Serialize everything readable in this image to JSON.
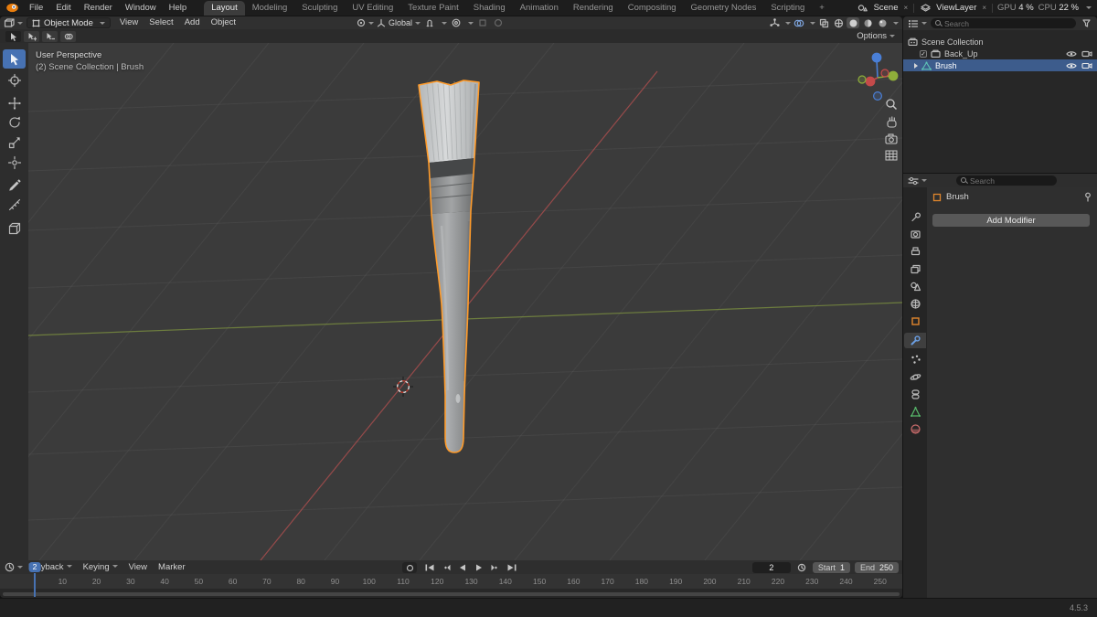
{
  "colors": {
    "accent_blue": "#4772b3",
    "selection_orange": "#ff9b2a",
    "axis_red": "#a84e4e",
    "axis_green": "#7b8e40",
    "outliner_selection": "#3d5c8c"
  },
  "icons": {
    "close": "×",
    "check": "✓"
  },
  "topbar": {
    "menus": [
      {
        "label": "File"
      },
      {
        "label": "Edit"
      },
      {
        "label": "Render"
      },
      {
        "label": "Window"
      },
      {
        "label": "Help"
      }
    ],
    "workspaces": [
      {
        "label": "Layout",
        "active": true
      },
      {
        "label": "Modeling"
      },
      {
        "label": "Sculpting"
      },
      {
        "label": "UV Editing"
      },
      {
        "label": "Texture Paint"
      },
      {
        "label": "Shading"
      },
      {
        "label": "Animation"
      },
      {
        "label": "Rendering"
      },
      {
        "label": "Compositing"
      },
      {
        "label": "Geometry Nodes"
      },
      {
        "label": "Scripting"
      },
      {
        "label": "+"
      }
    ],
    "scene_name": "Scene",
    "view_layer_name": "ViewLayer",
    "gpu_label": "GPU",
    "gpu_value": "4 %",
    "cpu_label": "CPU",
    "cpu_value": "22 %"
  },
  "viewport_header": {
    "mode": "Object Mode",
    "menus": [
      {
        "label": "View"
      },
      {
        "label": "Select"
      },
      {
        "label": "Add"
      },
      {
        "label": "Object"
      }
    ],
    "orientation": "Global"
  },
  "tool_settings": {
    "options_label": "Options"
  },
  "viewport": {
    "overlay_line1": "User Perspective",
    "overlay_line2": "(2) Scene Collection | Brush"
  },
  "outliner": {
    "search_placeholder": "Search",
    "scene_collection_label": "Scene Collection",
    "items": [
      {
        "label": "Back_Up"
      },
      {
        "label": "Brush",
        "selected": true
      }
    ]
  },
  "properties": {
    "search_placeholder": "Search",
    "breadcrumb_object": "Brush",
    "add_modifier_label": "Add Modifier"
  },
  "timeline": {
    "menus": [
      {
        "label": "Playback",
        "chevron": true
      },
      {
        "label": "Keying",
        "chevron": true
      },
      {
        "label": "View"
      },
      {
        "label": "Marker"
      }
    ],
    "current_frame": "2",
    "start_label": "Start",
    "start_value": "1",
    "end_label": "End",
    "end_value": "250",
    "ticks": [
      "10",
      "20",
      "30",
      "40",
      "50",
      "60",
      "70",
      "80",
      "90",
      "100",
      "110",
      "120",
      "130",
      "140",
      "150",
      "160",
      "170",
      "180",
      "190",
      "200",
      "210",
      "220",
      "230",
      "240",
      "250"
    ]
  },
  "statusbar": {
    "version": "4.5.3"
  }
}
